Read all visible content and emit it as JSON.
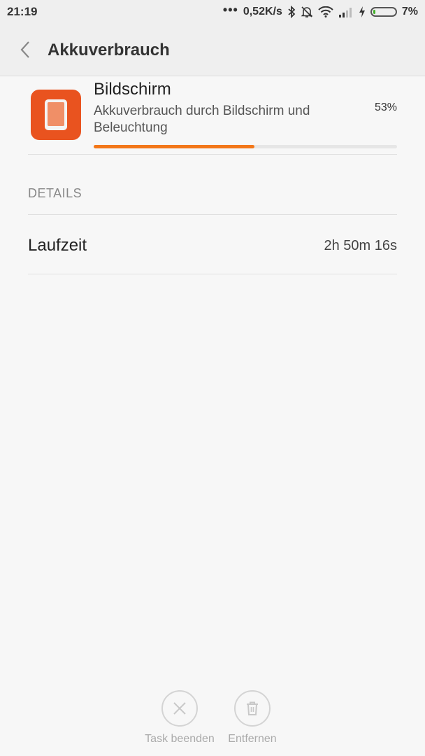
{
  "status_bar": {
    "time": "21:19",
    "dots": "•••",
    "net_speed": "0,52K/s",
    "battery_percent": "7%",
    "battery_level": 0.07,
    "icons": [
      "bluetooth-icon",
      "notifications-off-icon",
      "wifi-icon",
      "signal-icon",
      "charging-icon",
      "battery-icon"
    ]
  },
  "header": {
    "title": "Akkuverbrauch",
    "back_icon": "chevron-left-icon"
  },
  "usage_item": {
    "icon": "phone-screen-icon",
    "icon_color": "#e9531f",
    "title": "Bildschirm",
    "description": "Akkuverbrauch durch Bildschirm und Beleuchtung",
    "percent_label": "53%",
    "fraction": 0.53,
    "bar_color": "#f37719"
  },
  "details": {
    "section_title": "DETAILS",
    "rows": [
      {
        "label": "Laufzeit",
        "value": "2h 50m 16s"
      }
    ]
  },
  "actions": [
    {
      "icon": "close-icon",
      "label": "Task beenden"
    },
    {
      "icon": "trash-icon",
      "label": "Entfernen"
    }
  ]
}
